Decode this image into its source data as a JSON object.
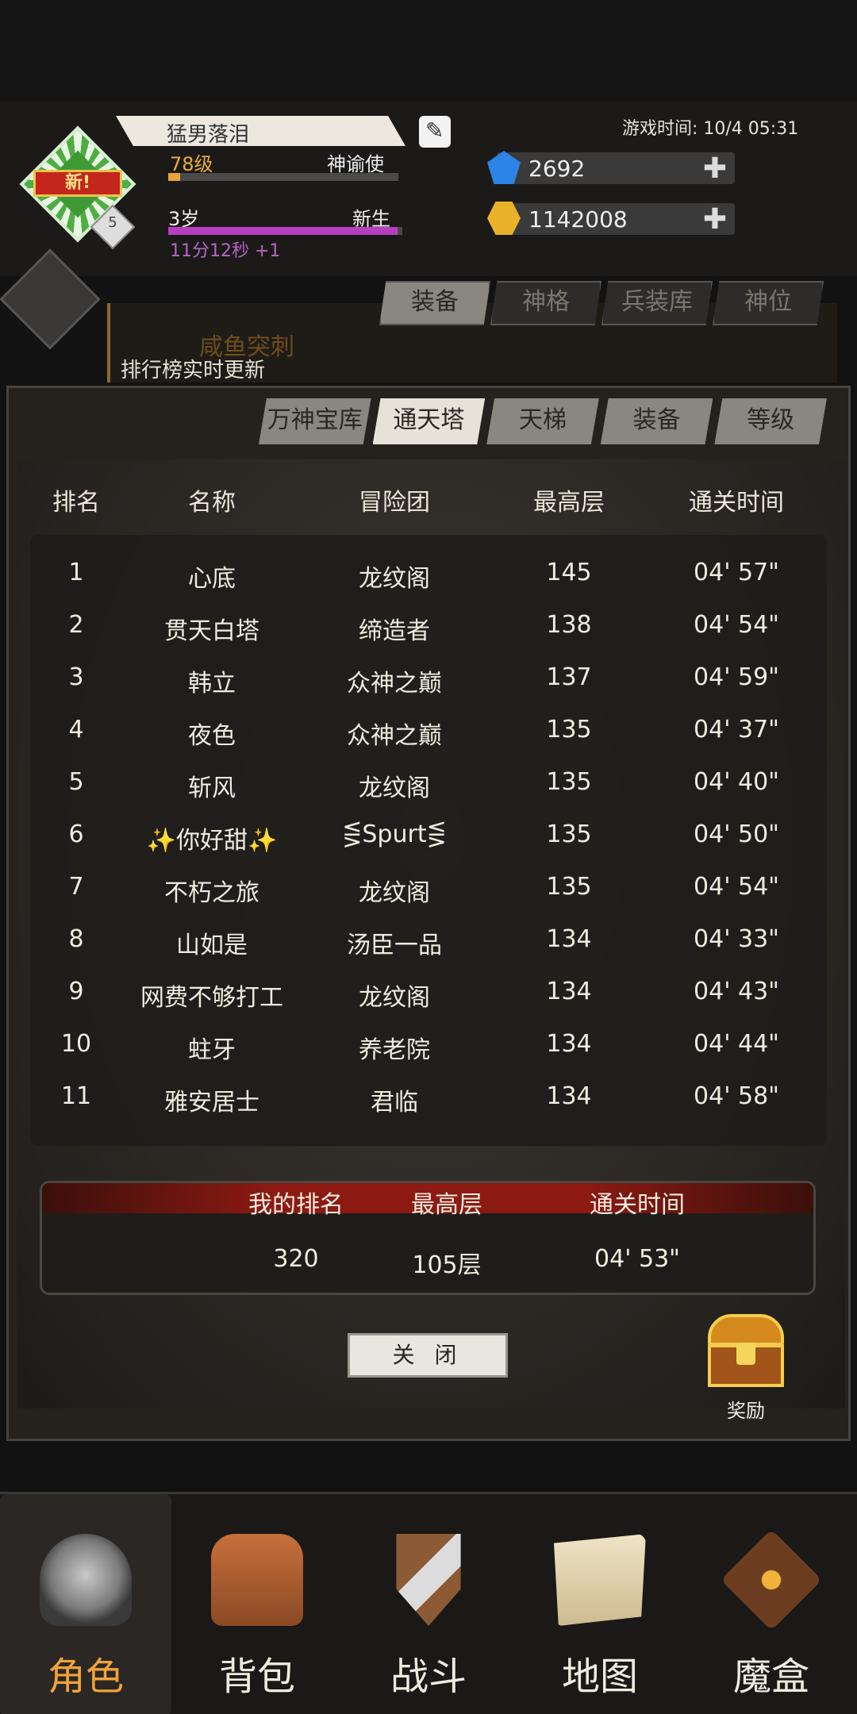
{
  "header": {
    "player_name": "猛男落泪",
    "level": "78级",
    "class": "神谕使",
    "age": "3岁",
    "stage": "新生",
    "timer": "11分12秒 +1",
    "avatar_tag": "新!",
    "avatar_rank": "5",
    "game_time": "游戏时间: 10/4 05:31",
    "gems": "2692",
    "gold": "1142008",
    "level_progress": 0.05,
    "age_progress": 0.98
  },
  "background": {
    "tabs": [
      "装备",
      "神格",
      "兵装库",
      "神位"
    ],
    "banner_title": "咸鱼突刺",
    "banner_note": "排行榜实时更新"
  },
  "modal": {
    "tabs": [
      "万神宝库",
      "通天塔",
      "天梯",
      "装备",
      "等级"
    ],
    "active_tab": "通天塔",
    "columns": [
      "排名",
      "名称",
      "冒险团",
      "最高层",
      "通关时间"
    ],
    "rows": [
      [
        "1",
        "心底",
        "龙纹阁",
        "145",
        "04' 57\""
      ],
      [
        "2",
        "贯天白塔",
        "缔造者",
        "138",
        "04' 54\""
      ],
      [
        "3",
        "韩立",
        "众神之巅",
        "137",
        "04' 59\""
      ],
      [
        "4",
        "夜色",
        "众神之巅",
        "135",
        "04' 37\""
      ],
      [
        "5",
        "斩风",
        "龙纹阁",
        "135",
        "04' 40\""
      ],
      [
        "6",
        "✨你好甜✨",
        "⋚Spurt⋚",
        "135",
        "04' 50\""
      ],
      [
        "7",
        "不朽之旅",
        "龙纹阁",
        "135",
        "04' 54\""
      ],
      [
        "8",
        "山如是",
        "汤臣一品",
        "134",
        "04' 33\""
      ],
      [
        "9",
        "网费不够打工",
        "龙纹阁",
        "134",
        "04' 43\""
      ],
      [
        "10",
        "蛀牙",
        "养老院",
        "134",
        "04' 44\""
      ],
      [
        "11",
        "雅安居士",
        "君临",
        "134",
        "04' 58\""
      ]
    ],
    "my_rank": {
      "headers": [
        "我的排名",
        "最高层",
        "通关时间"
      ],
      "values": [
        "320",
        "105层",
        "04' 53\""
      ]
    },
    "close_label": "关 闭",
    "reward_label": "奖励"
  },
  "nav": {
    "items": [
      {
        "label": "角色",
        "icon": "helmet-icon"
      },
      {
        "label": "背包",
        "icon": "backpack-icon"
      },
      {
        "label": "战斗",
        "icon": "sword-shield-icon"
      },
      {
        "label": "地图",
        "icon": "scroll-map-icon"
      },
      {
        "label": "魔盒",
        "icon": "magic-box-icon"
      }
    ],
    "selected": "角色"
  },
  "colors": {
    "accent_orange": "#f1a33a",
    "gold_text": "#e9ad3c",
    "purple_text": "#b864c6",
    "my_rank_header": "#8d1a12"
  }
}
